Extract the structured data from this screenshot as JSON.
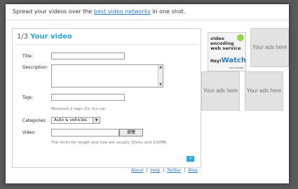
{
  "header": {
    "text_before": "Spread your videos over the",
    "link": "best video networks",
    "text_after": "in one shot."
  },
  "form": {
    "step": "1/3",
    "title": "Your video",
    "title_label": "Title:",
    "title_value": "",
    "description_label": "Description:",
    "description_value": "",
    "tags_label": "Tags:",
    "tags_value": "",
    "tags_hint": "Minimum 2 tags. Ex: fun car",
    "categories_label": "Categories:",
    "category_selected": "Auto & vehicles",
    "video_label": "Video:",
    "video_value": "",
    "browse_label": "瀏覽",
    "video_hint": "The limits for length and size are usually 10min and 100MB.",
    "next_label": "»"
  },
  "ads": {
    "heywatch_text": [
      "video",
      "encoding",
      "web service"
    ],
    "heywatch_brand_prefix": "Hey!",
    "heywatch_brand": "Watch",
    "heywatch_tagline": "Just encode",
    "placeholder_1": "Your ads here",
    "placeholder_2": "Your ads here",
    "placeholder_3": "Your ads here"
  },
  "footer": {
    "about": "About",
    "help": "Help",
    "twitter": "Twitter",
    "blog": "Blog",
    "separator": "|"
  }
}
